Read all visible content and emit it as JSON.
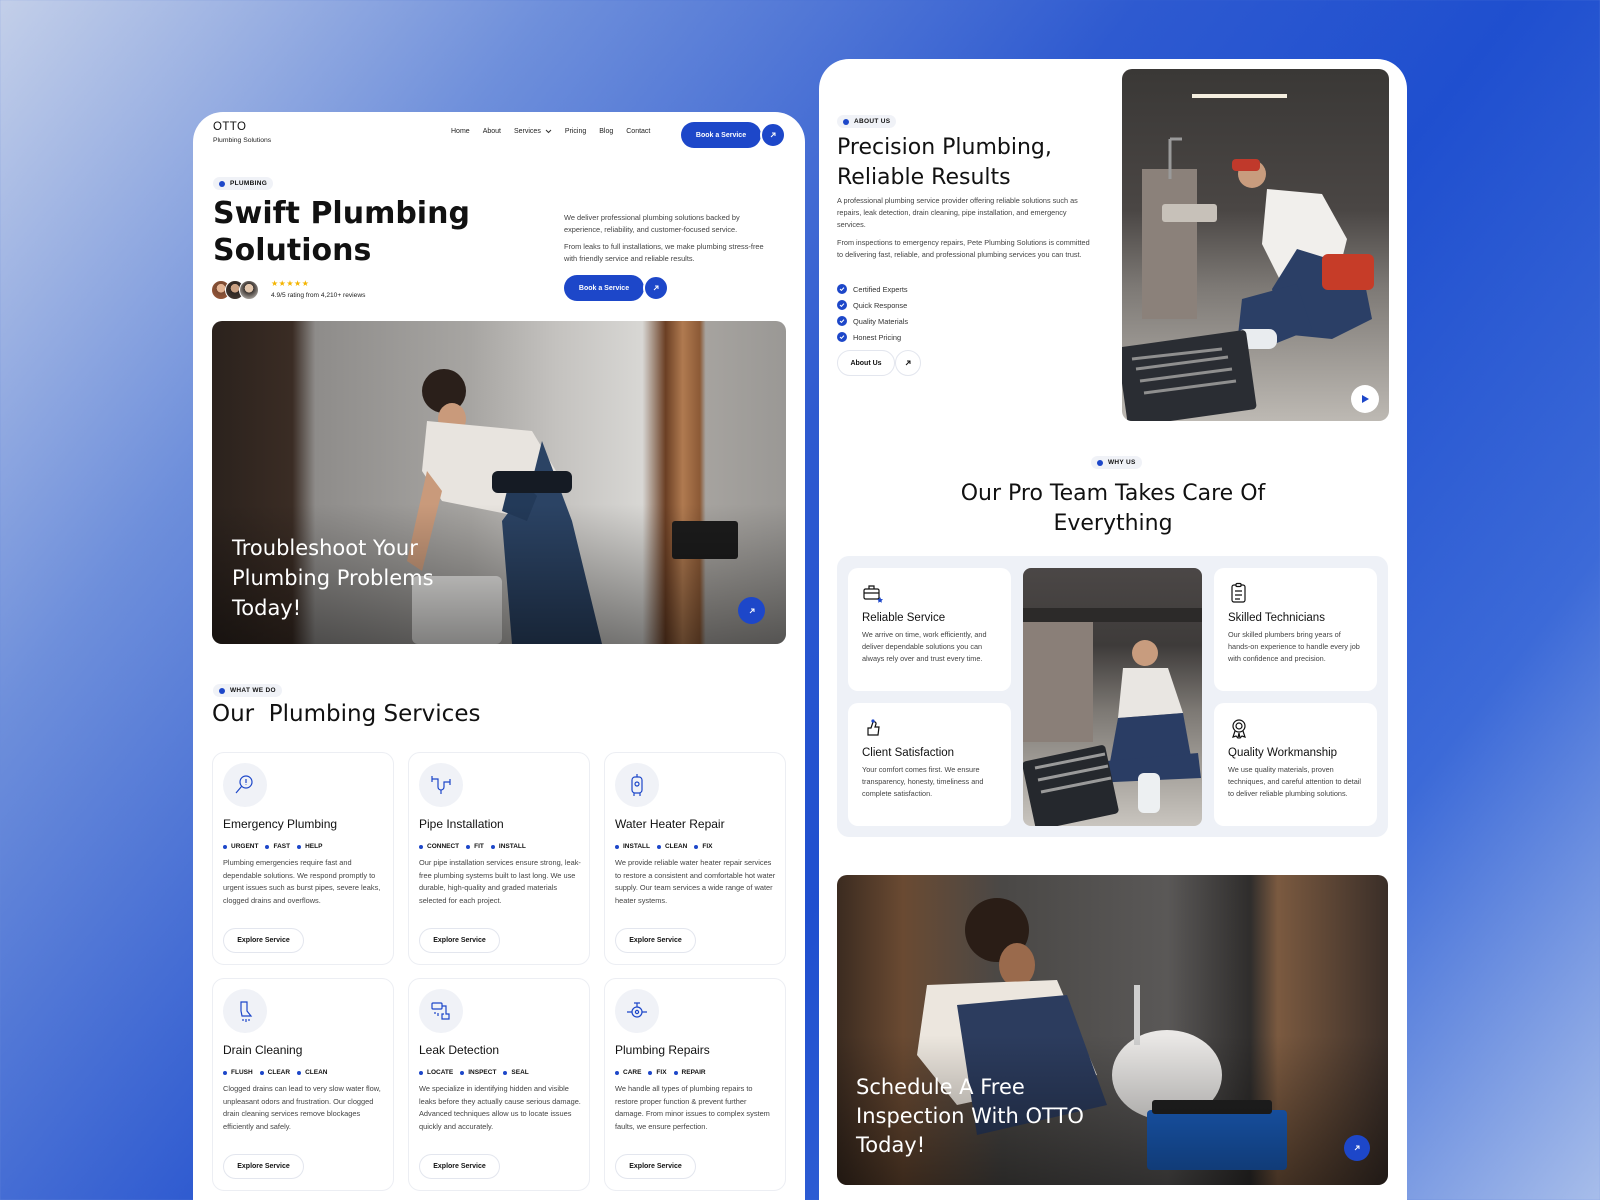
{
  "left": {
    "brand": {
      "name": "OTTO",
      "tagline": "Plumbing Solutions"
    },
    "nav": {
      "items": [
        "Home",
        "About",
        "Services",
        "Pricing",
        "Blog",
        "Contact"
      ],
      "cta": "Book a Service"
    },
    "hero": {
      "pill": "PLUMBING",
      "title_line1": "Swift Plumbing",
      "title_line2": "Solutions",
      "rating_stars": "★★★★★",
      "rating_text": "4.9/5 rating from 4,210+ reviews",
      "desc1": "We deliver professional plumbing solutions backed by experience, reliability, and customer-focused service.",
      "desc2": "From leaks to full installations, we make plumbing stress-free with friendly service and reliable results.",
      "cta": "Book a Service",
      "banner_line1": "Troubleshoot Your",
      "banner_line2": "Plumbing Problems",
      "banner_line3": "Today!"
    },
    "services": {
      "pill": "WHAT WE DO",
      "title": "Our  Plumbing Services",
      "explore_label": "Explore Service",
      "cards": [
        {
          "title": "Emergency Plumbing",
          "tags": [
            "URGENT",
            "FAST",
            "HELP"
          ],
          "desc": "Plumbing emergencies require fast and dependable solutions. We respond promptly to urgent issues such as burst pipes, severe leaks, clogged drains and overflows."
        },
        {
          "title": "Pipe Installation",
          "tags": [
            "CONNECT",
            "FIT",
            "INSTALL"
          ],
          "desc": "Our pipe installation services ensure strong, leak-free plumbing systems built to last long. We use durable, high-quality and graded materials selected for each project."
        },
        {
          "title": "Water Heater Repair",
          "tags": [
            "INSTALL",
            "CLEAN",
            "FIX"
          ],
          "desc": "We provide reliable water heater repair services to restore a consistent and comfortable hot water supply. Our team services a wide range of water heater systems."
        },
        {
          "title": "Drain Cleaning",
          "tags": [
            "FLUSH",
            "CLEAR",
            "CLEAN"
          ],
          "desc": "Clogged drains can lead to very slow water flow, unpleasant odors and frustration. Our clogged drain cleaning services remove blockages efficiently and safely."
        },
        {
          "title": "Leak Detection",
          "tags": [
            "LOCATE",
            "INSPECT",
            "SEAL"
          ],
          "desc": "We specialize in identifying hidden and visible leaks before they actually cause serious damage. Advanced techniques allow us to locate issues quickly and accurately."
        },
        {
          "title": "Plumbing Repairs",
          "tags": [
            "CARE",
            "FIX",
            "REPAIR"
          ],
          "desc": "We handle all types of plumbing repairs to restore proper function & prevent further damage. From minor issues to complex system faults, we ensure perfection."
        }
      ]
    }
  },
  "right": {
    "about": {
      "pill": "ABOUT US",
      "title_line1": "Precision Plumbing,",
      "title_line2": "Reliable Results",
      "desc1": "A professional plumbing service provider offering reliable solutions such as repairs, leak detection, drain cleaning, pipe installation, and emergency services.",
      "desc2": "From inspections to emergency repairs, Pete Plumbing Solutions is committed to delivering fast, reliable, and professional plumbing services you can trust.",
      "checks": [
        "Certified Experts",
        "Quick Response",
        "Quality Materials",
        "Honest Pricing"
      ],
      "cta": "About Us"
    },
    "why": {
      "pill": "WHY US",
      "title_line1": "Our Pro Team Takes Care Of",
      "title_line2": "Everything",
      "cards": [
        {
          "title": "Reliable Service",
          "desc": "We arrive on time, work efficiently, and deliver dependable solutions you can always rely over and trust every time."
        },
        {
          "title": "Skilled Technicians",
          "desc": "Our skilled plumbers bring years of hands-on experience to handle every job with confidence and precision."
        },
        {
          "title": "Client Satisfaction",
          "desc": "Your comfort comes first. We ensure transparency, honesty, timeliness and complete satisfaction."
        },
        {
          "title": "Quality Workmanship",
          "desc": "We use quality materials, proven techniques, and careful attention to detail to deliver reliable plumbing solutions."
        }
      ]
    },
    "cta_banner": {
      "line1": "Schedule A Free",
      "line2": "Inspection With OTTO",
      "line3": "Today!"
    }
  },
  "colors": {
    "accent": "#1d47c9",
    "star": "#f4b400"
  }
}
